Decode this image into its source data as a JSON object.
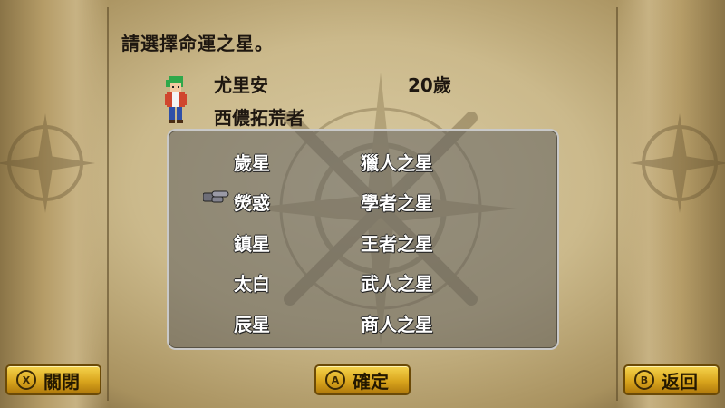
{
  "dialog": {
    "prompt": "請選擇命運之星。"
  },
  "character": {
    "name": "尤里安",
    "age": "20歲",
    "class": "西儂拓荒者"
  },
  "stars": {
    "left": [
      "歲星",
      "熒惑",
      "鎮星",
      "太白",
      "辰星"
    ],
    "right": [
      "獵人之星",
      "學者之星",
      "王者之星",
      "武人之星",
      "商人之星"
    ],
    "selected_index": 1
  },
  "buttons": {
    "close": {
      "key": "X",
      "label": "關閉"
    },
    "confirm": {
      "key": "A",
      "label": "確定"
    },
    "back": {
      "key": "B",
      "label": "返回"
    }
  },
  "colors": {
    "button_gold": "#e0b22a",
    "panel_gray": "#5f5f5f",
    "text_dark": "#1e1710"
  },
  "icons": {
    "cursor": "pointing-gauntlet-icon",
    "character": "character-sprite"
  }
}
